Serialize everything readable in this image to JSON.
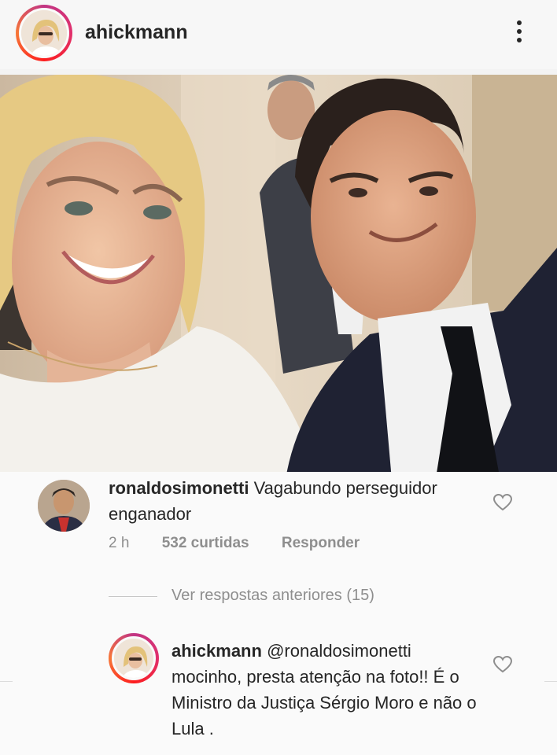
{
  "post": {
    "username": "ahickmann",
    "more_icon": "more-vertical-icon"
  },
  "comment": {
    "username": "ronaldosimonetti",
    "text": "Vagabundo perseguidor enganador",
    "time": "2 h",
    "likes": "532 curtidas",
    "reply_label": "Responder",
    "heart_icon": "heart-outline-icon"
  },
  "view_replies": "Ver respostas anteriores (15)",
  "reply": {
    "username": "ahickmann",
    "mention": "@ronaldosimonetti",
    "text": "mocinho, presta atenção na foto!! É o Ministro da Justiça Sérgio Moro e não o Lula .",
    "heart_icon": "heart-outline-icon"
  },
  "colors": {
    "text": "#262626",
    "secondary": "#8e8e8e",
    "background": "#fafafa"
  }
}
